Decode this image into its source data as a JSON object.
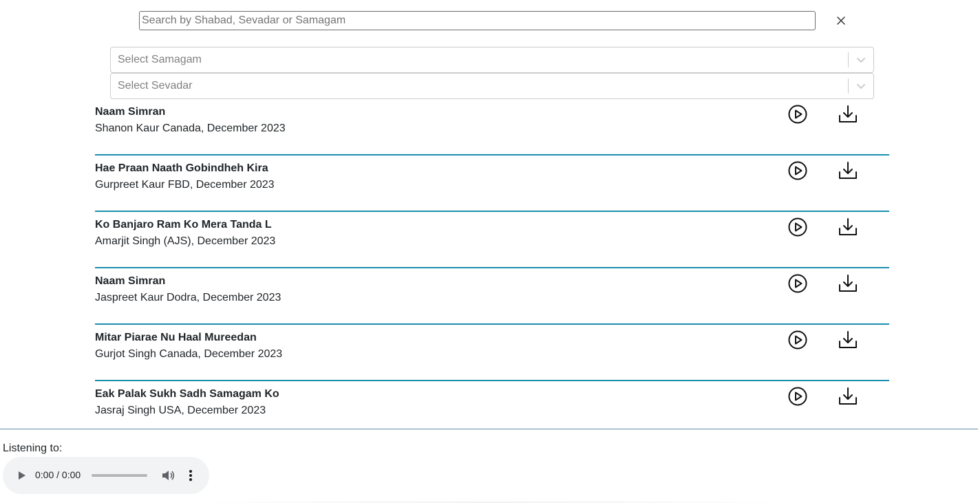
{
  "search": {
    "placeholder": "Search by Shabad, Sevadar or Samagam",
    "value": ""
  },
  "filters": {
    "samagam_placeholder": "Select Samagam",
    "sevadar_placeholder": "Select Sevadar"
  },
  "colors": {
    "divider": "#1a8fae",
    "footer_border": "#5a8ea8",
    "player_bg": "#f1f3f4"
  },
  "shabads": [
    {
      "title": "Naam Simran",
      "meta": "Shanon Kaur Canada, December 2023"
    },
    {
      "title": "Hae Praan Naath Gobindheh Kira",
      "meta": "Gurpreet Kaur FBD, December 2023"
    },
    {
      "title": "Ko Banjaro Ram Ko Mera Tanda L",
      "meta": "Amarjit Singh (AJS), December 2023"
    },
    {
      "title": "Naam Simran",
      "meta": "Jaspreet Kaur Dodra, December 2023"
    },
    {
      "title": "Mitar Piarae Nu Haal Mureedan",
      "meta": "Gurjot Singh Canada, December 2023"
    },
    {
      "title": "Eak Palak Sukh Sadh Samagam Ko",
      "meta": "Jasraj Singh USA, December 2023"
    }
  ],
  "row_icons": {
    "play": "play-circle-icon",
    "download": "download-icon"
  },
  "player": {
    "listening_label": "Listening to:",
    "time": "0:00 / 0:00",
    "progress": 0
  }
}
